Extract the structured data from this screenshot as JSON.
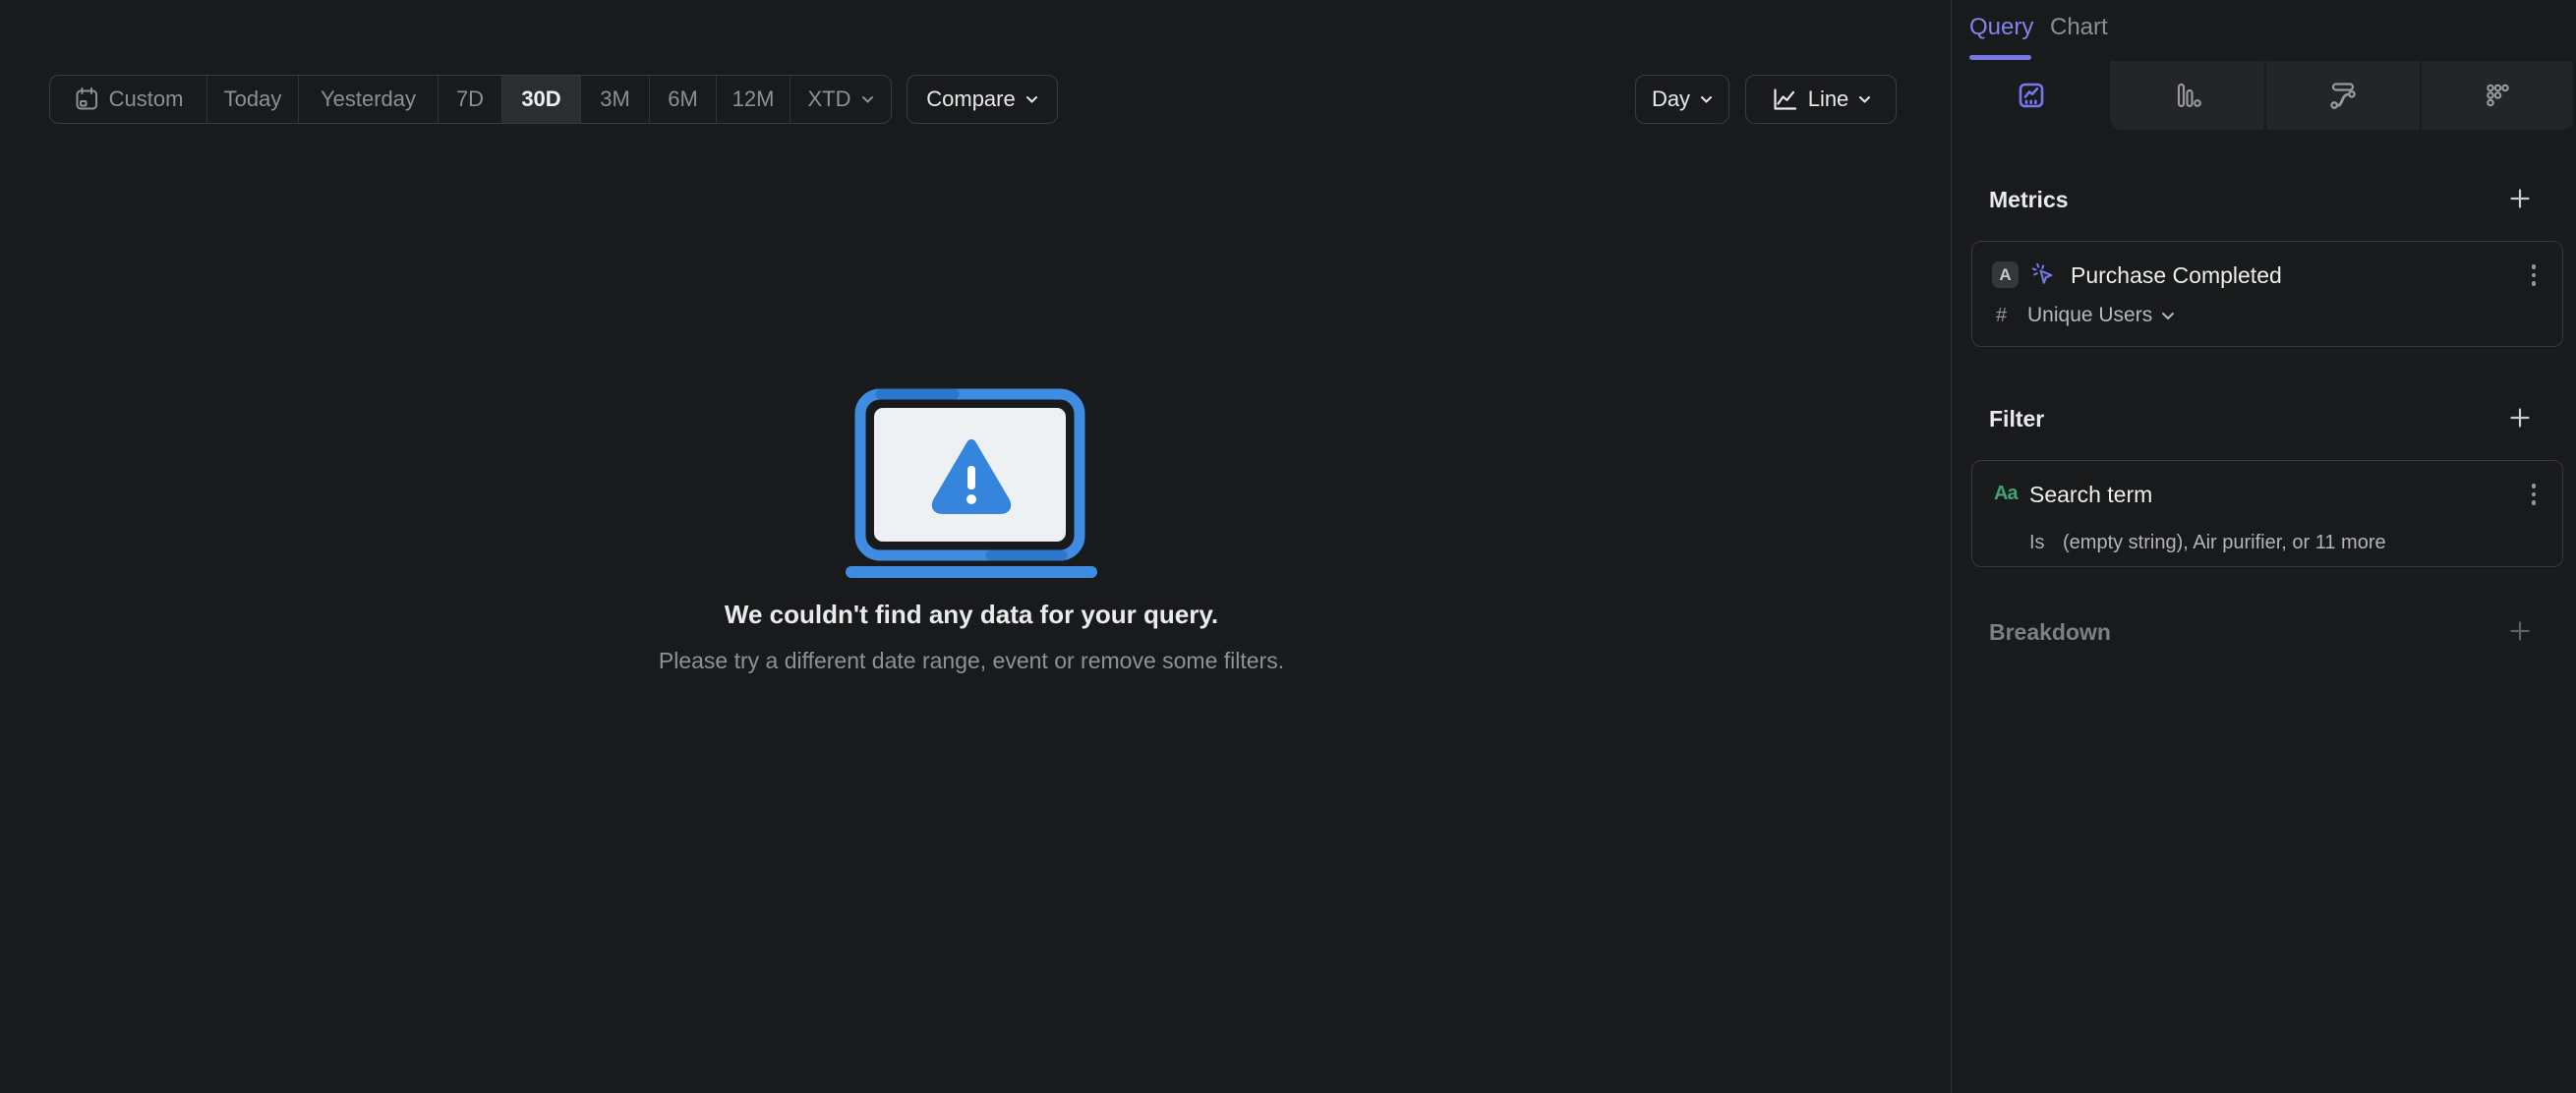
{
  "colors": {
    "background": "#191a1c",
    "accent_purple": "#7678ee",
    "accent_blue": "#3f8de2",
    "accent_green": "#3fa573",
    "active_segment_bg": "#2b2d31",
    "inactive_tab_bg": "#242528"
  },
  "toolbar": {
    "date_ranges": [
      {
        "label": "Custom",
        "icon": "calendar-icon",
        "active": false
      },
      {
        "label": "Today",
        "active": false
      },
      {
        "label": "Yesterday",
        "active": false
      },
      {
        "label": "7D",
        "active": false
      },
      {
        "label": "30D",
        "active": true
      },
      {
        "label": "3M",
        "active": false
      },
      {
        "label": "6M",
        "active": false
      },
      {
        "label": "12M",
        "active": false
      },
      {
        "label": "XTD",
        "active": false,
        "has_dropdown": true
      }
    ],
    "compare_label": "Compare",
    "granularity_label": "Day",
    "chart_type_label": "Line"
  },
  "empty_state": {
    "title": "We couldn't find any data for your query.",
    "subtitle": "Please try a different date range, event or remove some filters.",
    "illustration": "laptop-warning-icon"
  },
  "sidebar": {
    "tabs": [
      {
        "label": "Query",
        "active": true
      },
      {
        "label": "Chart",
        "active": false
      }
    ],
    "chart_type_tabs": [
      {
        "icon": "insights-chart-icon",
        "active": true
      },
      {
        "icon": "funnels-chart-icon",
        "active": false
      },
      {
        "icon": "flows-chart-icon",
        "active": false
      },
      {
        "icon": "retention-chart-icon",
        "active": false
      }
    ],
    "metrics": {
      "heading": "Metrics",
      "items": [
        {
          "letter": "A",
          "event_icon": "event-cursor-icon",
          "event": "Purchase Completed",
          "aggregation_prefix": "#",
          "aggregation": "Unique Users"
        }
      ]
    },
    "filter": {
      "heading": "Filter",
      "items": [
        {
          "type_badge": "Aa",
          "property": "Search term",
          "operator": "Is",
          "value": "(empty string), Air purifier, or 11 more"
        }
      ]
    },
    "breakdown": {
      "heading": "Breakdown"
    }
  }
}
